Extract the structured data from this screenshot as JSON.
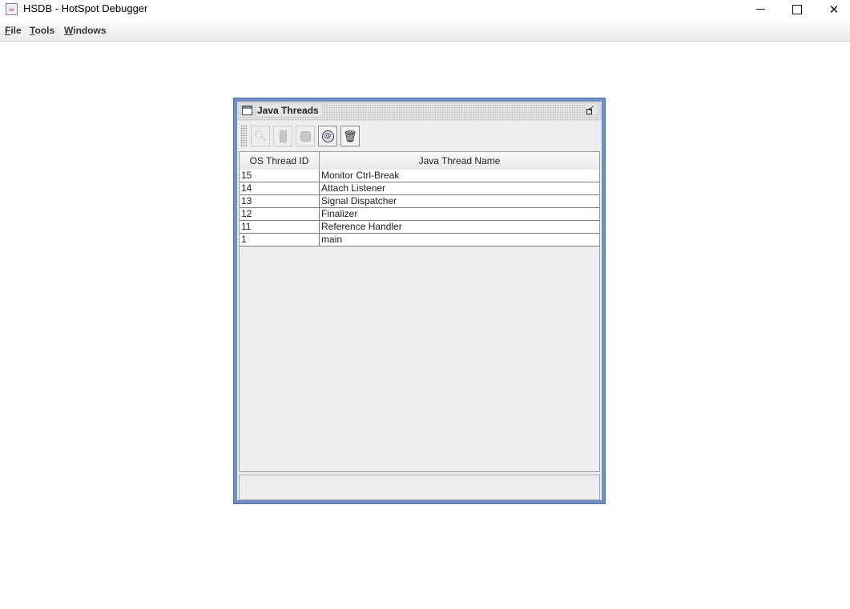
{
  "window": {
    "title": "HSDB - HotSpot Debugger",
    "controls": {
      "minimize": "minimize",
      "maximize": "maximize",
      "close": "close"
    }
  },
  "menubar": {
    "items": [
      {
        "mnemonic": "F",
        "rest": "ile"
      },
      {
        "mnemonic": "T",
        "rest": "ools"
      },
      {
        "mnemonic": "W",
        "rest": "indows"
      }
    ]
  },
  "internal_frame": {
    "title": "Java Threads",
    "toolbar": {
      "buttons": [
        {
          "icon": "magnifier-icon",
          "enabled": false
        },
        {
          "icon": "bar-icon",
          "enabled": false
        },
        {
          "icon": "stack-icon",
          "enabled": false
        },
        {
          "icon": "thread-info-icon",
          "enabled": true
        },
        {
          "icon": "trash-icon",
          "enabled": true
        }
      ]
    },
    "table": {
      "columns": [
        "OS Thread ID",
        "Java Thread Name"
      ],
      "rows": [
        [
          "15",
          "Monitor Ctrl-Break"
        ],
        [
          "14",
          "Attach Listener"
        ],
        [
          "13",
          "Signal Dispatcher"
        ],
        [
          "12",
          "Finalizer"
        ],
        [
          "11",
          "Reference Handler"
        ],
        [
          "1",
          "main"
        ]
      ]
    }
  },
  "colors": {
    "frame_border": "#6e8fc7",
    "panel_bg": "#eeeeee",
    "table_row_bg": "#ffffff"
  }
}
